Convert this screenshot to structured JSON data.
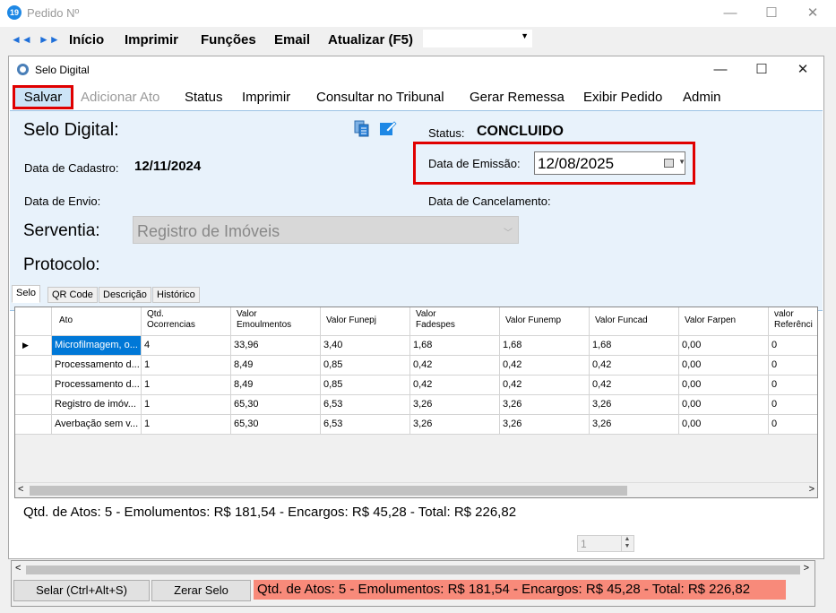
{
  "outer_window": {
    "title": "Pedido Nº",
    "app_icon_text": "19",
    "controls": {
      "minimize": "—",
      "maximize": "☐",
      "close": "✕"
    },
    "nav_back": "◄◄",
    "nav_forward": "►►",
    "menu": [
      "Início",
      "Imprimir",
      "Funções",
      "Email",
      "Atualizar (F5)"
    ],
    "combo_value": ""
  },
  "inner_window": {
    "title": "Selo Digital",
    "controls": {
      "minimize": "—",
      "maximize": "☐",
      "close": "✕"
    },
    "menu": {
      "salvar": "Salvar",
      "items": [
        "Adicionar Ato",
        "Status",
        "Imprimir",
        "Consultar no Tribunal",
        "Gerar Remessa",
        "Exibir Pedido",
        "Admin"
      ]
    }
  },
  "form": {
    "section_title": "Selo Digital:",
    "status_label": "Status:",
    "status_value": "CONCLUIDO",
    "cadastro_label": "Data de Cadastro:",
    "cadastro_value": "12/11/2024",
    "emissao_label": "Data de Emissão:",
    "emissao_value": "12/08/2025",
    "envio_label": "Data de Envio:",
    "cancelamento_label": "Data de Cancelamento:",
    "serventia_label": "Serventia:",
    "serventia_value": "Registro de Imóveis",
    "protocolo_label": "Protocolo:"
  },
  "tabs": [
    "Selo",
    "QR Code",
    "Descrição",
    "Histórico"
  ],
  "grid": {
    "columns": [
      {
        "line1": "Ato",
        "line2": ""
      },
      {
        "line1": "Qtd.",
        "line2": "Ocorrencias"
      },
      {
        "line1": "Valor",
        "line2": "Emoulmentos"
      },
      {
        "line1": "Valor Funepj",
        "line2": ""
      },
      {
        "line1": "Valor",
        "line2": "Fadespes"
      },
      {
        "line1": "Valor Funemp",
        "line2": ""
      },
      {
        "line1": "Valor Funcad",
        "line2": ""
      },
      {
        "line1": "Valor Farpen",
        "line2": ""
      },
      {
        "line1": "valor",
        "line2": "Referênci"
      }
    ],
    "rows": [
      [
        "Microfilmagem, o...",
        "4",
        "33,96",
        "3,40",
        "1,68",
        "1,68",
        "1,68",
        "0,00",
        "0"
      ],
      [
        "Processamento d...",
        "1",
        "8,49",
        "0,85",
        "0,42",
        "0,42",
        "0,42",
        "0,00",
        "0"
      ],
      [
        "Processamento d...",
        "1",
        "8,49",
        "0,85",
        "0,42",
        "0,42",
        "0,42",
        "0,00",
        "0"
      ],
      [
        "Registro de imóv...",
        "1",
        "65,30",
        "6,53",
        "3,26",
        "3,26",
        "3,26",
        "0,00",
        "0"
      ],
      [
        "Averbação sem v...",
        "1",
        "65,30",
        "6,53",
        "3,26",
        "3,26",
        "3,26",
        "0,00",
        "0"
      ]
    ]
  },
  "summary": "Qtd. de Atos: 5  -   Emolumentos: R$ 181,54   -   Encargos: R$ 45,28   -   Total: R$ 226,82",
  "spinner_value": "1",
  "bottom": {
    "salvar_selo": "Selar (Ctrl+Alt+S)",
    "zerar_selo": "Zerar Selo",
    "summary": "Qtd. de Atos: 5   -   Emolumentos: R$ 181,54   -   Encargos: R$ 45,28   -   Total: R$ 226,82"
  }
}
